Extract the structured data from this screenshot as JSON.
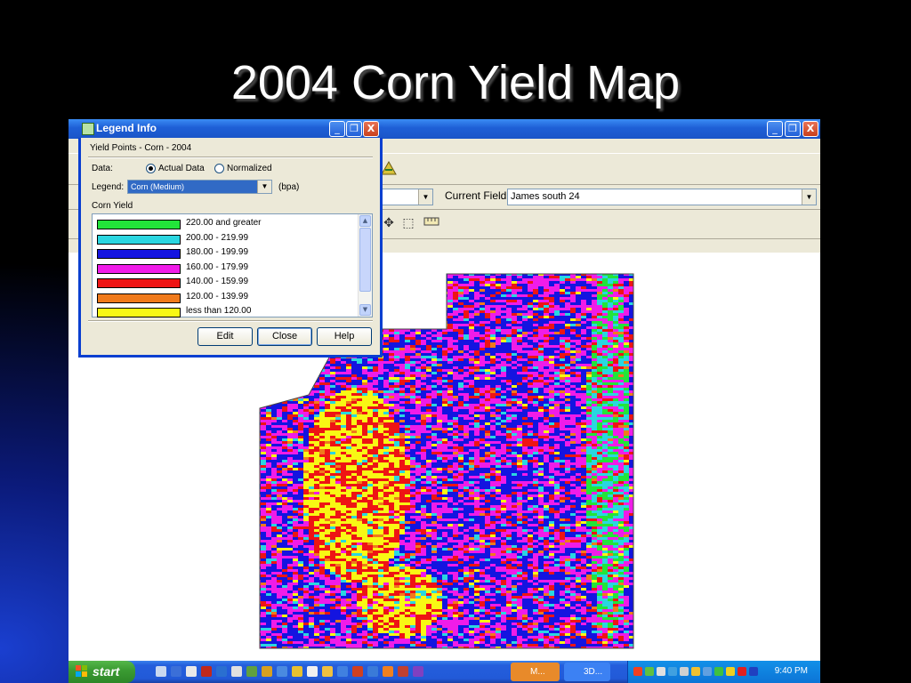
{
  "slide": {
    "title": "2004 Corn Yield Map"
  },
  "app": {
    "current_field_label": "Current Field:",
    "current_field_value": "James south 24",
    "window_buttons": {
      "minimize": "_",
      "restore": "❐",
      "close": "X"
    }
  },
  "legend_dialog": {
    "title": "Legend Info",
    "subtitle": "Yield Points - Corn - 2004",
    "data_label": "Data:",
    "data_options": [
      {
        "label": "Actual Data",
        "selected": true
      },
      {
        "label": "Normalized",
        "selected": false
      }
    ],
    "legend_label": "Legend:",
    "legend_value": "Corn (Medium)",
    "unit": "(bpa)",
    "section_label": "Corn Yield",
    "entries": [
      {
        "label": "220.00 and greater",
        "color": "#22e43a"
      },
      {
        "label": "200.00  -  219.99",
        "color": "#2ad6e0"
      },
      {
        "label": "180.00  -  199.99",
        "color": "#1414e0"
      },
      {
        "label": "160.00  -  179.99",
        "color": "#f01ce8"
      },
      {
        "label": "140.00  -  159.99",
        "color": "#ee1414"
      },
      {
        "label": "120.00  -  139.99",
        "color": "#f07a1c"
      },
      {
        "label": "less than 120.00",
        "color": "#f8f814"
      }
    ],
    "buttons": {
      "edit": "Edit",
      "close": "Close",
      "help": "Help"
    }
  },
  "taskbar": {
    "start_label": "start",
    "tasks": [
      {
        "label": "M..."
      },
      {
        "label": "3D..."
      }
    ],
    "clock": "9:40 PM"
  },
  "colors": {
    "accent": "#1e5fd6",
    "map_palette": [
      "#1414e0",
      "#f01ce8",
      "#ee1414",
      "#f8f814",
      "#2ad6e0",
      "#22e43a",
      "#f07a1c"
    ]
  }
}
